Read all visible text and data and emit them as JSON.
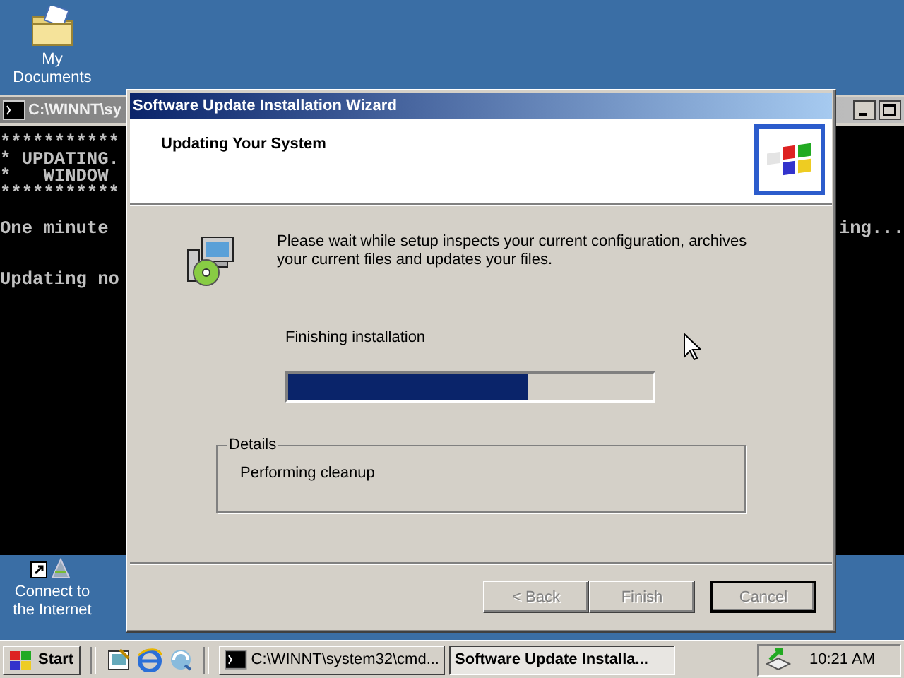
{
  "desktop_icons": [
    {
      "label": "My Documents",
      "kind": "documents"
    },
    {
      "label": "Connect to the Internet",
      "kind": "connect"
    }
  ],
  "console": {
    "title": "C:\\WINNT\\sy",
    "blocks": [
      [
        {
          "text": "***********"
        },
        {
          "text": "* UPDATING."
        },
        {
          "text": "*   WINDOW"
        },
        {
          "text": "***********"
        }
      ],
      [
        {
          "text": "One minute",
          "tail": "ing..."
        }
      ],
      [
        {
          "text": "Updating no"
        }
      ]
    ]
  },
  "wizard": {
    "title": "Software Update Installation Wizard",
    "header_title": "Updating Your System",
    "message": "Please wait while setup inspects your current configuration, archives your current files and updates your files.",
    "status": "Finishing installation",
    "progress": {
      "level": 0.66
    },
    "details_label": "Details",
    "details_text": "Performing cleanup",
    "buttons": [
      {
        "label": "< Back",
        "disabled": true,
        "default": false
      },
      {
        "label": "Finish",
        "disabled": true,
        "default": false
      },
      {
        "label": "Cancel",
        "disabled": true,
        "default": true
      }
    ]
  },
  "taskbar": {
    "start": "Start",
    "tasks": [
      {
        "label": "C:\\WINNT\\system32\\cmd...",
        "kind": "console",
        "selected": false
      },
      {
        "label": "Software Update Installa...",
        "kind": "window",
        "selected": true
      }
    ],
    "clock": "10:21 AM"
  }
}
